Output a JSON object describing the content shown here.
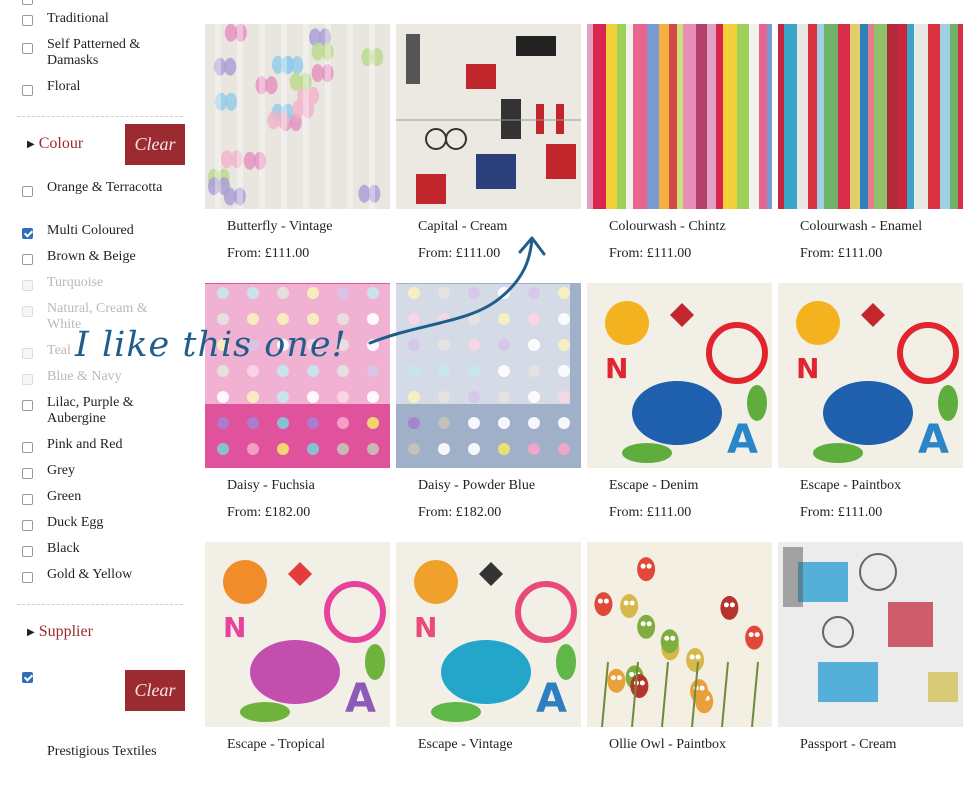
{
  "filters": {
    "style_items": [
      {
        "label": "Traditional"
      },
      {
        "label": "Self Patterned & Damasks"
      },
      {
        "label": "Floral"
      }
    ],
    "colour_section": {
      "label": "Colour",
      "clear_label": "Clear"
    },
    "colour_items": [
      {
        "label": "Orange & Terracotta",
        "checked": false,
        "disabled": false
      },
      {
        "label": "Multi Coloured",
        "checked": true,
        "disabled": false
      },
      {
        "label": "Brown & Beige",
        "checked": false,
        "disabled": false
      },
      {
        "label": "Turquoise",
        "checked": false,
        "disabled": true
      },
      {
        "label": "Natural, Cream & White",
        "checked": false,
        "disabled": true
      },
      {
        "label": "Teal",
        "checked": false,
        "disabled": true
      },
      {
        "label": "Blue & Navy",
        "checked": false,
        "disabled": true
      },
      {
        "label": "Lilac, Purple & Aubergine",
        "checked": false,
        "disabled": false
      },
      {
        "label": "Pink and Red",
        "checked": false,
        "disabled": false
      },
      {
        "label": "Grey",
        "checked": false,
        "disabled": false
      },
      {
        "label": "Green",
        "checked": false,
        "disabled": false
      },
      {
        "label": "Duck Egg",
        "checked": false,
        "disabled": false
      },
      {
        "label": "Black",
        "checked": false,
        "disabled": false
      },
      {
        "label": "Gold & Yellow",
        "checked": false,
        "disabled": false
      }
    ],
    "supplier_section": {
      "label": "Supplier",
      "clear_label": "Clear"
    },
    "supplier_items": [
      {
        "label": "Prestigious Textiles",
        "checked": true
      }
    ]
  },
  "products": [
    {
      "title": "Butterfly - Vintage",
      "price": "From: £111.00",
      "swatch": "butterfly"
    },
    {
      "title": "Capital - Cream",
      "price": "From: £111.00",
      "swatch": "capital"
    },
    {
      "title": "Colourwash - Chintz",
      "price": "From: £111.00",
      "swatch": "stripes-a"
    },
    {
      "title": "Colourwash - Enamel",
      "price": "From: £111.00",
      "swatch": "stripes-b"
    },
    {
      "title": "Daisy - Fuchsia",
      "price": "From: £182.00",
      "swatch": "daisy-pink"
    },
    {
      "title": "Daisy - Powder Blue",
      "price": "From: £182.00",
      "swatch": "daisy-blue"
    },
    {
      "title": "Escape - Denim",
      "price": "From: £111.00",
      "swatch": "escape"
    },
    {
      "title": "Escape - Paintbox",
      "price": "From: £111.00",
      "swatch": "escape"
    },
    {
      "title": "Escape - Tropical",
      "price": "",
      "swatch": "escape-pink"
    },
    {
      "title": "Escape - Vintage",
      "price": "",
      "swatch": "escape-teal"
    },
    {
      "title": "Ollie Owl - Paintbox",
      "price": "",
      "swatch": "owls"
    },
    {
      "title": "Passport - Cream",
      "price": "",
      "swatch": "passport"
    }
  ],
  "annotation": {
    "text": "I like this one!",
    "color": "#1f5d8a"
  },
  "colors": {
    "accent": "#9c2b31",
    "link": "#9a2a2f",
    "checkbox": "#2f6fb7"
  }
}
